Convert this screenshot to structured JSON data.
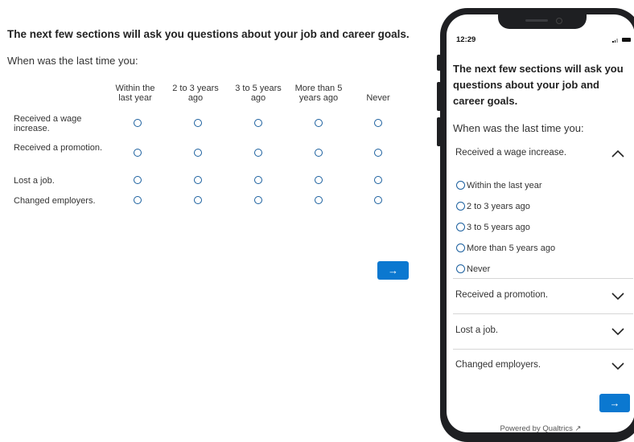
{
  "survey": {
    "heading": "The next few sections will ask you questions about your job and career goals.",
    "prompt": "When was the last time you:",
    "columns": [
      "Within the last year",
      "2 to 3 years ago",
      "3 to 5 years ago",
      "More than 5 years ago",
      "Never"
    ],
    "rows": [
      "Received a wage increase.",
      "Received a promotion.",
      "Lost a job.",
      "Changed employers."
    ],
    "next_label": "→",
    "accent": "#0b78d0",
    "radio_color": "#1a5f9e"
  },
  "mobile": {
    "time": "12:29",
    "heading": "The next few sections will ask you questions about your job and career goals.",
    "prompt": "When was the last time you:",
    "accordions": [
      {
        "label": "Received a wage increase.",
        "expanded": true
      },
      {
        "label": "Received a promotion.",
        "expanded": false
      },
      {
        "label": "Lost a job.",
        "expanded": false
      },
      {
        "label": "Changed employers.",
        "expanded": false
      }
    ],
    "options": [
      "Within the last year",
      "2 to 3 years ago",
      "3 to 5 years ago",
      "More than 5 years ago",
      "Never"
    ],
    "next_label": "→",
    "powered_by": "Powered by Qualtrics ↗"
  }
}
